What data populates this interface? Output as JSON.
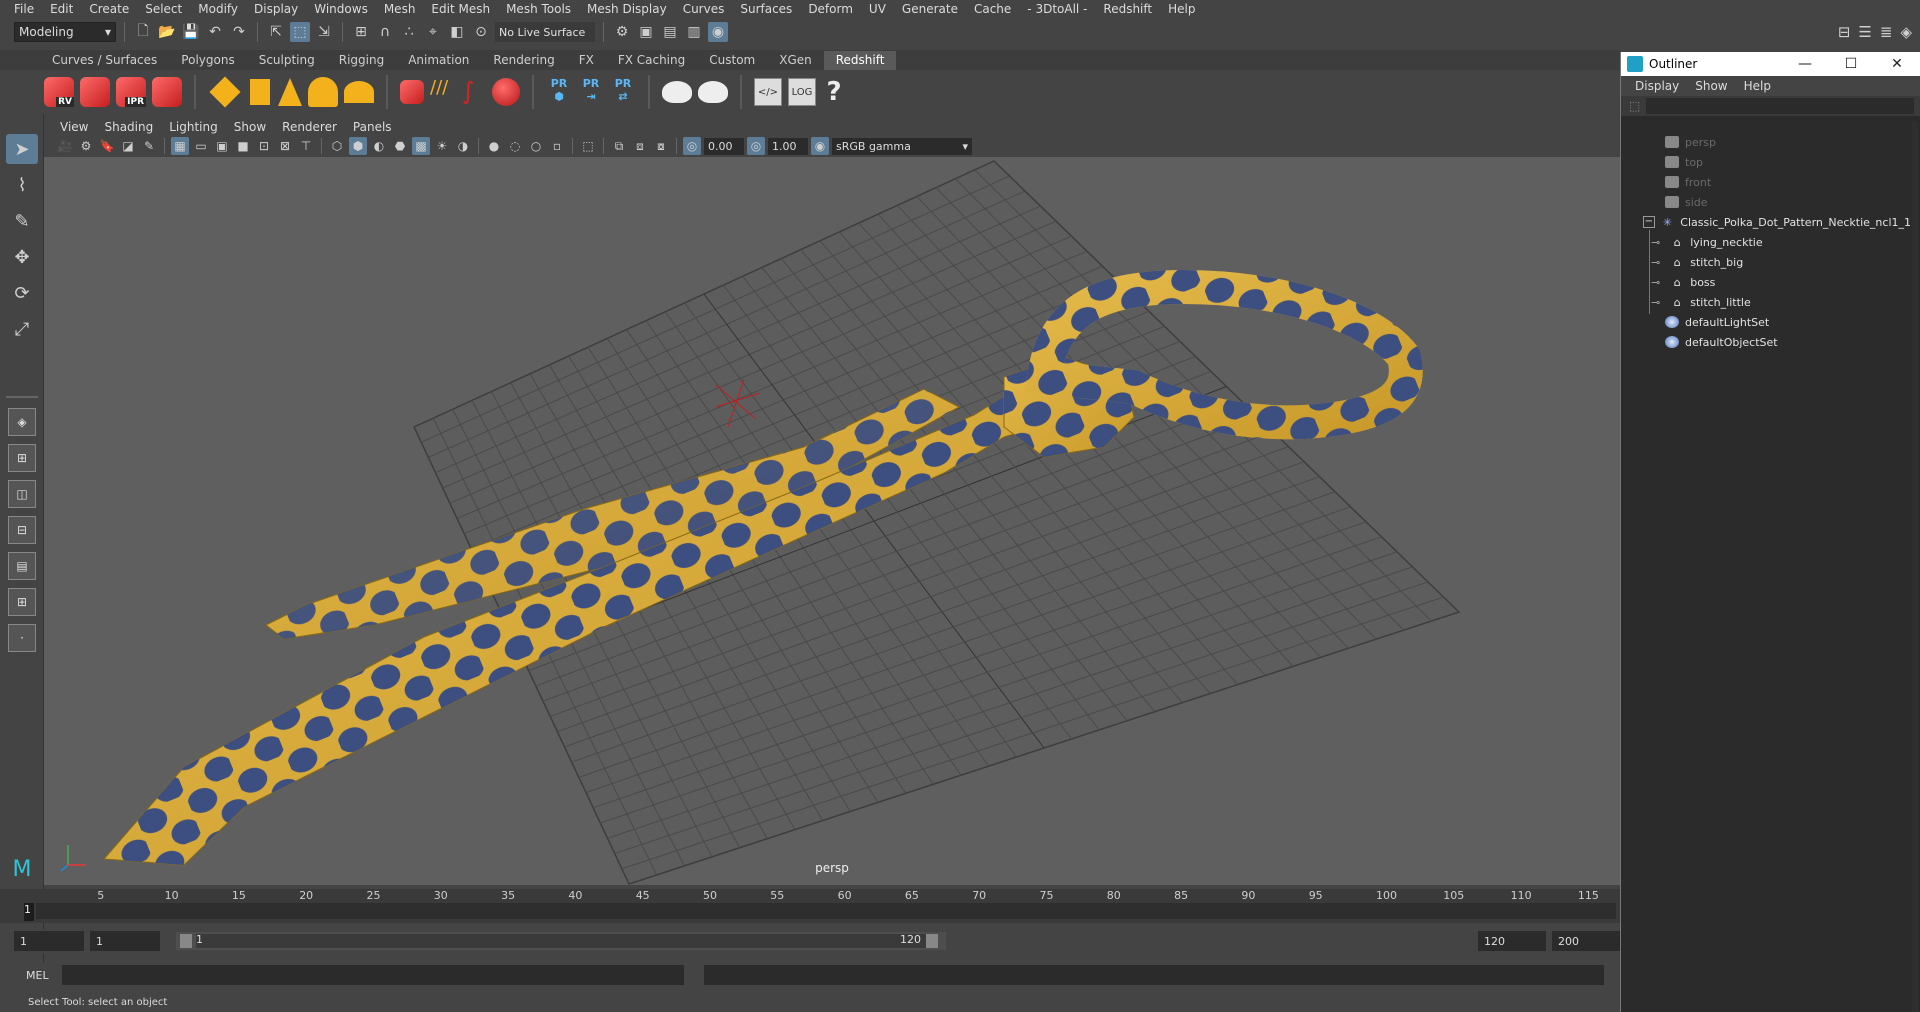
{
  "menubar": {
    "items": [
      "File",
      "Edit",
      "Create",
      "Select",
      "Modify",
      "Display",
      "Windows",
      "Mesh",
      "Edit Mesh",
      "Mesh Tools",
      "Mesh Display",
      "Curves",
      "Surfaces",
      "Deform",
      "UV",
      "Generate",
      "Cache",
      "- 3DtoAll -",
      "Redshift",
      "Help"
    ]
  },
  "statusline": {
    "mode": "Modeling",
    "live_surface": "No Live Surface"
  },
  "shelf": {
    "tabs": [
      "Curves / Surfaces",
      "Polygons",
      "Sculpting",
      "Rigging",
      "Animation",
      "Rendering",
      "FX",
      "FX Caching",
      "Custom",
      "XGen",
      "Redshift"
    ],
    "active_tab": "Redshift",
    "labels": {
      "rv": "RV",
      "ipr": "IPR",
      "pr1": "PR",
      "pr2": "PR",
      "pr3": "PR",
      "log": "LOG",
      "help": "?"
    }
  },
  "panel": {
    "menu": [
      "View",
      "Shading",
      "Lighting",
      "Show",
      "Renderer",
      "Panels"
    ],
    "exposure": "0.00",
    "gamma": "1.00",
    "color_space": "sRGB gamma",
    "camera_label": "persp"
  },
  "timeslider": {
    "ticks": [
      "5",
      "10",
      "15",
      "20",
      "25",
      "30",
      "35",
      "40",
      "45",
      "50",
      "55",
      "60",
      "65",
      "70",
      "75",
      "80",
      "85",
      "90",
      "95",
      "100",
      "105",
      "110",
      "115"
    ],
    "current_frame": "1"
  },
  "rangeslider": {
    "start": "1",
    "current": "1",
    "range_start": "1",
    "range_end": "120",
    "end": "120",
    "max": "200"
  },
  "cmdline": {
    "language": "MEL"
  },
  "helpline": {
    "text": "Select Tool: select an object"
  },
  "outliner": {
    "title": "Outliner",
    "menu": [
      "Display",
      "Show",
      "Help"
    ],
    "cameras": [
      "persp",
      "top",
      "front",
      "side"
    ],
    "group": "Classic_Polka_Dot_Pattern_Necktie_ncl1_1",
    "children": [
      "lying_necktie",
      "stitch_big",
      "boss",
      "stitch_little"
    ],
    "sets": [
      "defaultLightSet",
      "defaultObjectSet"
    ]
  },
  "colors": {
    "tie": "#d8ac3a",
    "dots": "#3d4f80",
    "active_tool": "#5d7d96"
  }
}
